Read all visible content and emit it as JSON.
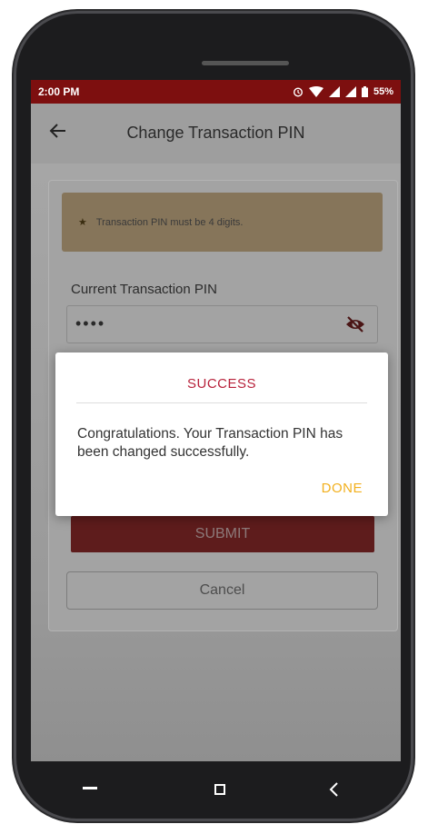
{
  "status_bar": {
    "time": "2:00 PM",
    "battery": "55%",
    "icons": [
      "alarm-icon",
      "wifi-icon",
      "signal-icon",
      "signal-icon",
      "battery-icon"
    ]
  },
  "app_bar": {
    "title": "Change Transaction PIN",
    "back_icon": "back-arrow-icon"
  },
  "form": {
    "notice": "Transaction PIN must be 4 digits.",
    "current_pin_label": "Current Transaction PIN",
    "current_pin_value": "••••",
    "visibility_icon": "eye-off-icon",
    "submit_label": "SUBMIT",
    "cancel_label": "Cancel"
  },
  "dialog": {
    "title": "SUCCESS",
    "message": "Congratulations. Your Transaction PIN has been changed successfully.",
    "done_label": "DONE"
  },
  "colors": {
    "status_bar": "#7d0f0f",
    "dialog_title": "#b8223b",
    "done": "#f2b01e"
  }
}
